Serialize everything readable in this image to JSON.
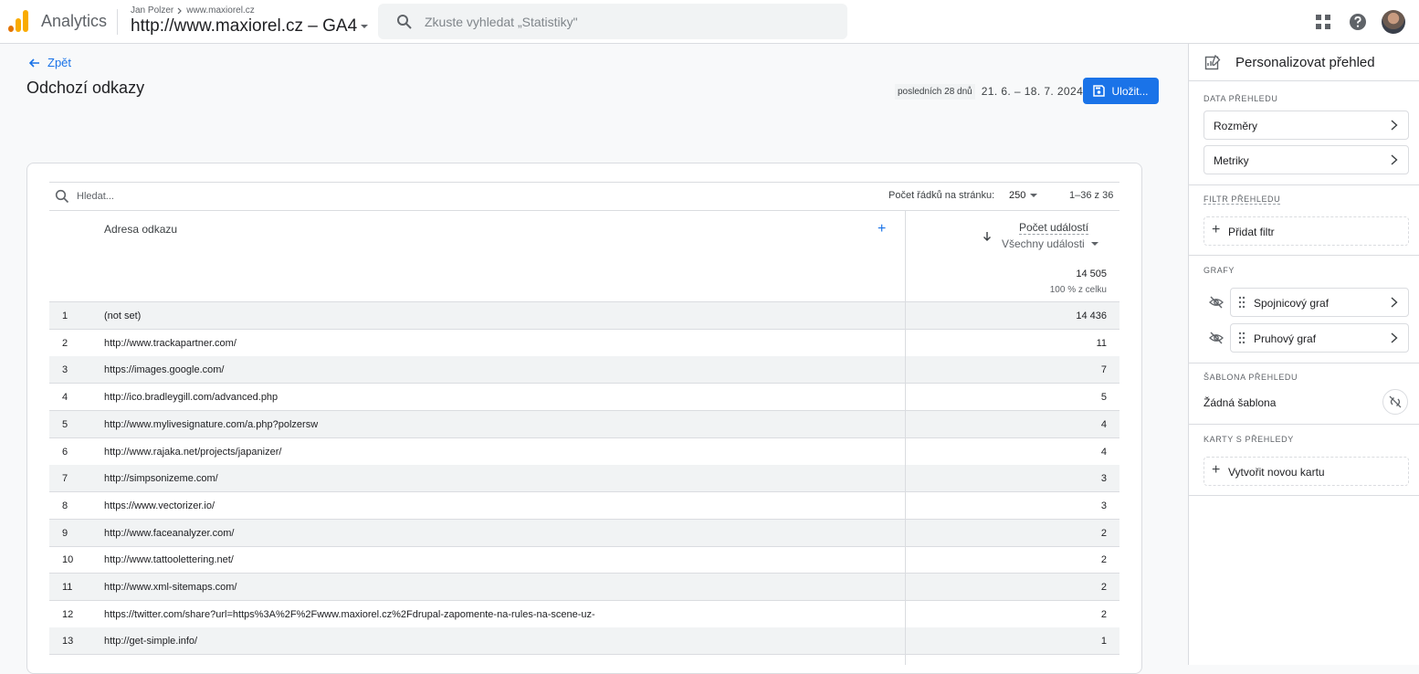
{
  "header": {
    "app_name": "Analytics",
    "account": "Jan Polzer",
    "property_crumb": "www.maxiorel.cz",
    "property_title": "http://www.maxiorel.cz – GA4",
    "search_placeholder": "Zkuste vyhledat „Statistiky\""
  },
  "page": {
    "back_label": "Zpět",
    "title": "Odchozí odkazy",
    "date_label": "posledních 28 dnů",
    "date_range": "21. 6. – 18. 7. 2024",
    "save_label": "Uložit..."
  },
  "table": {
    "search_placeholder": "Hledat...",
    "rows_per_page_label": "Počet řádků na stránku:",
    "rows_per_page": "250",
    "range": "1–36 z 36",
    "dimension_header": "Adresa odkazu",
    "metric_header": "Počet událostí",
    "metric_filter": "Všechny události",
    "total": "14 505",
    "total_sub": "100 % z celku",
    "rows": [
      {
        "idx": "1",
        "url": "(not set)",
        "value": "14 436"
      },
      {
        "idx": "2",
        "url": "http://www.trackapartner.com/",
        "value": "11"
      },
      {
        "idx": "3",
        "url": "https://images.google.com/",
        "value": "7"
      },
      {
        "idx": "4",
        "url": "http://ico.bradleygill.com/advanced.php",
        "value": "5"
      },
      {
        "idx": "5",
        "url": "http://www.mylivesignature.com/a.php?polzersw",
        "value": "4"
      },
      {
        "idx": "6",
        "url": "http://www.rajaka.net/projects/japanizer/",
        "value": "4"
      },
      {
        "idx": "7",
        "url": "http://simpsonizeme.com/",
        "value": "3"
      },
      {
        "idx": "8",
        "url": "https://www.vectorizer.io/",
        "value": "3"
      },
      {
        "idx": "9",
        "url": "http://www.faceanalyzer.com/",
        "value": "2"
      },
      {
        "idx": "10",
        "url": "http://www.tattoolettering.net/",
        "value": "2"
      },
      {
        "idx": "11",
        "url": "http://www.xml-sitemaps.com/",
        "value": "2"
      },
      {
        "idx": "12",
        "url": "https://twitter.com/share?url=https%3A%2F%2Fwww.maxiorel.cz%2Fdrupal-zapomente-na-rules-na-scene-uz-",
        "value": "2"
      },
      {
        "idx": "13",
        "url": "http://get-simple.info/",
        "value": "1"
      }
    ]
  },
  "panel": {
    "title": "Personalizovat přehled",
    "data_section": "DATA PŘEHLEDU",
    "dimensions": "Rozměry",
    "metrics": "Metriky",
    "filter_section": "FILTR PŘEHLEDU",
    "add_filter": "Přidat filtr",
    "charts_section": "GRAFY",
    "line_chart": "Spojnicový graf",
    "bar_chart": "Pruhový graf",
    "template_section": "ŠABLONA PŘEHLEDU",
    "template_value": "Žádná šablona",
    "cards_section": "KARTY S PŘEHLEDY",
    "new_card": "Vytvořit novou kartu"
  },
  "colors": {
    "accent": "#1a73e8",
    "logo": "#f9ab00",
    "row_stripe": "#f1f3f4"
  }
}
